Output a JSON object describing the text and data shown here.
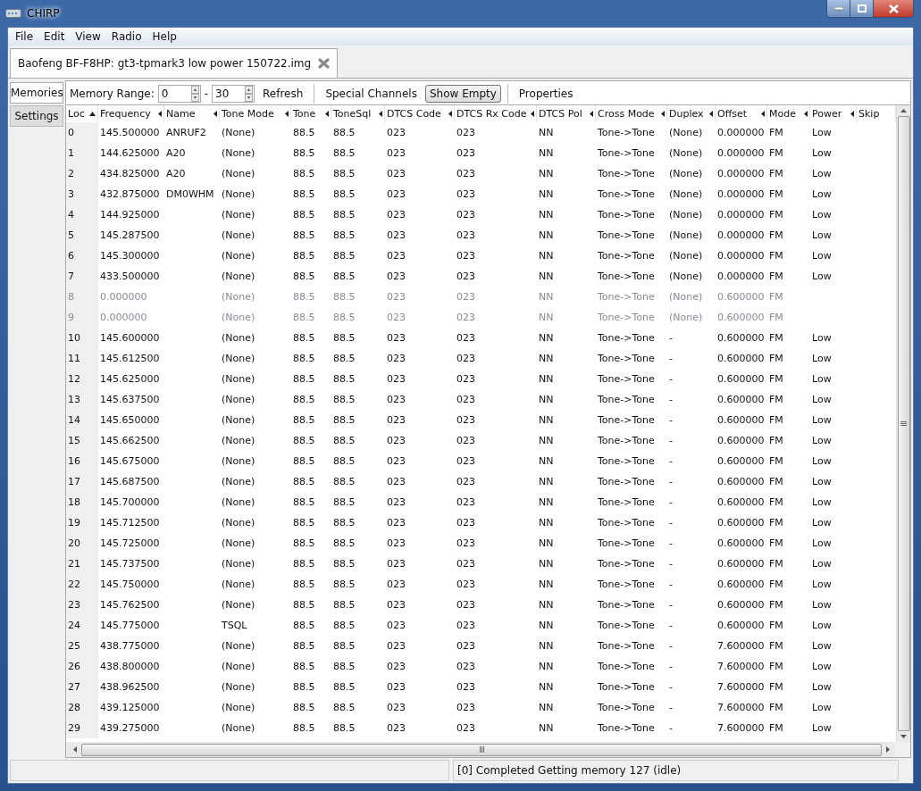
{
  "window": {
    "title": "CHIRP"
  },
  "menu": [
    "File",
    "Edit",
    "View",
    "Radio",
    "Help"
  ],
  "file_tab": {
    "label": "Baofeng BF-F8HP: gt3-tpmark3 low power 150722.img",
    "selected": true
  },
  "side_tabs": [
    {
      "label": "Memories",
      "selected": true
    },
    {
      "label": "Settings",
      "selected": false
    }
  ],
  "toolbar": {
    "range_label": "Memory Range:",
    "range_start": "0",
    "range_sep": "-",
    "range_end": "30",
    "refresh": "Refresh",
    "special": "Special Channels",
    "show_empty": {
      "label": "Show Empty",
      "on": true
    },
    "properties": "Properties"
  },
  "table": {
    "columns": [
      {
        "label": "Loc",
        "sorted": true
      },
      {
        "label": "Frequency",
        "sorted": false
      },
      {
        "label": "Name",
        "sorted": false
      },
      {
        "label": "Tone Mode",
        "sorted": false
      },
      {
        "label": "Tone",
        "sorted": false
      },
      {
        "label": "ToneSql",
        "sorted": false
      },
      {
        "label": "DTCS Code",
        "sorted": false
      },
      {
        "label": "DTCS Rx Code",
        "sorted": false
      },
      {
        "label": "DTCS Pol",
        "sorted": false
      },
      {
        "label": "Cross Mode",
        "sorted": false
      },
      {
        "label": "Duplex",
        "sorted": false
      },
      {
        "label": "Offset",
        "sorted": false
      },
      {
        "label": "Mode",
        "sorted": false
      },
      {
        "label": "Power",
        "sorted": false
      },
      {
        "label": "Skip"
      }
    ],
    "rows": [
      {
        "empty": false,
        "cells": [
          "0",
          "145.500000",
          "ANRUF2",
          "(None)",
          "88.5",
          "88.5",
          "023",
          "023",
          "NN",
          "Tone->Tone",
          "(None)",
          "0.000000",
          "FM",
          "Low"
        ]
      },
      {
        "empty": false,
        "cells": [
          "1",
          "144.625000",
          "A20",
          "(None)",
          "88.5",
          "88.5",
          "023",
          "023",
          "NN",
          "Tone->Tone",
          "(None)",
          "0.000000",
          "FM",
          "Low"
        ]
      },
      {
        "empty": false,
        "cells": [
          "2",
          "434.825000",
          "A20",
          "(None)",
          "88.5",
          "88.5",
          "023",
          "023",
          "NN",
          "Tone->Tone",
          "(None)",
          "0.000000",
          "FM",
          "Low"
        ]
      },
      {
        "empty": false,
        "cells": [
          "3",
          "432.875000",
          "DM0WHM",
          "(None)",
          "88.5",
          "88.5",
          "023",
          "023",
          "NN",
          "Tone->Tone",
          "(None)",
          "0.000000",
          "FM",
          "Low"
        ]
      },
      {
        "empty": false,
        "cells": [
          "4",
          "144.925000",
          null,
          "(None)",
          "88.5",
          "88.5",
          "023",
          "023",
          "NN",
          "Tone->Tone",
          "(None)",
          "0.000000",
          "FM",
          "Low"
        ]
      },
      {
        "empty": false,
        "cells": [
          "5",
          "145.287500",
          null,
          "(None)",
          "88.5",
          "88.5",
          "023",
          "023",
          "NN",
          "Tone->Tone",
          "(None)",
          "0.000000",
          "FM",
          "Low"
        ]
      },
      {
        "empty": false,
        "cells": [
          "6",
          "145.300000",
          null,
          "(None)",
          "88.5",
          "88.5",
          "023",
          "023",
          "NN",
          "Tone->Tone",
          "(None)",
          "0.000000",
          "FM",
          "Low"
        ]
      },
      {
        "empty": false,
        "cells": [
          "7",
          "433.500000",
          null,
          "(None)",
          "88.5",
          "88.5",
          "023",
          "023",
          "NN",
          "Tone->Tone",
          "(None)",
          "0.000000",
          "FM",
          "Low"
        ]
      },
      {
        "empty": true,
        "cells": [
          "8",
          "0.000000",
          null,
          "(None)",
          "88.5",
          "88.5",
          "023",
          "023",
          "NN",
          "Tone->Tone",
          "(None)",
          "0.600000",
          "FM",
          null
        ]
      },
      {
        "empty": true,
        "cells": [
          "9",
          "0.000000",
          null,
          "(None)",
          "88.5",
          "88.5",
          "023",
          "023",
          "NN",
          "Tone->Tone",
          "(None)",
          "0.600000",
          "FM",
          null
        ]
      },
      {
        "empty": false,
        "cells": [
          "10",
          "145.600000",
          null,
          "(None)",
          "88.5",
          "88.5",
          "023",
          "023",
          "NN",
          "Tone->Tone",
          "-",
          "0.600000",
          "FM",
          "Low"
        ]
      },
      {
        "empty": false,
        "cells": [
          "11",
          "145.612500",
          null,
          "(None)",
          "88.5",
          "88.5",
          "023",
          "023",
          "NN",
          "Tone->Tone",
          "-",
          "0.600000",
          "FM",
          "Low"
        ]
      },
      {
        "empty": false,
        "cells": [
          "12",
          "145.625000",
          null,
          "(None)",
          "88.5",
          "88.5",
          "023",
          "023",
          "NN",
          "Tone->Tone",
          "-",
          "0.600000",
          "FM",
          "Low"
        ]
      },
      {
        "empty": false,
        "cells": [
          "13",
          "145.637500",
          null,
          "(None)",
          "88.5",
          "88.5",
          "023",
          "023",
          "NN",
          "Tone->Tone",
          "-",
          "0.600000",
          "FM",
          "Low"
        ]
      },
      {
        "empty": false,
        "cells": [
          "14",
          "145.650000",
          null,
          "(None)",
          "88.5",
          "88.5",
          "023",
          "023",
          "NN",
          "Tone->Tone",
          "-",
          "0.600000",
          "FM",
          "Low"
        ]
      },
      {
        "empty": false,
        "cells": [
          "15",
          "145.662500",
          null,
          "(None)",
          "88.5",
          "88.5",
          "023",
          "023",
          "NN",
          "Tone->Tone",
          "-",
          "0.600000",
          "FM",
          "Low"
        ]
      },
      {
        "empty": false,
        "cells": [
          "16",
          "145.675000",
          null,
          "(None)",
          "88.5",
          "88.5",
          "023",
          "023",
          "NN",
          "Tone->Tone",
          "-",
          "0.600000",
          "FM",
          "Low"
        ]
      },
      {
        "empty": false,
        "cells": [
          "17",
          "145.687500",
          null,
          "(None)",
          "88.5",
          "88.5",
          "023",
          "023",
          "NN",
          "Tone->Tone",
          "-",
          "0.600000",
          "FM",
          "Low"
        ]
      },
      {
        "empty": false,
        "cells": [
          "18",
          "145.700000",
          null,
          "(None)",
          "88.5",
          "88.5",
          "023",
          "023",
          "NN",
          "Tone->Tone",
          "-",
          "0.600000",
          "FM",
          "Low"
        ]
      },
      {
        "empty": false,
        "cells": [
          "19",
          "145.712500",
          null,
          "(None)",
          "88.5",
          "88.5",
          "023",
          "023",
          "NN",
          "Tone->Tone",
          "-",
          "0.600000",
          "FM",
          "Low"
        ]
      },
      {
        "empty": false,
        "cells": [
          "20",
          "145.725000",
          null,
          "(None)",
          "88.5",
          "88.5",
          "023",
          "023",
          "NN",
          "Tone->Tone",
          "-",
          "0.600000",
          "FM",
          "Low"
        ]
      },
      {
        "empty": false,
        "cells": [
          "21",
          "145.737500",
          null,
          "(None)",
          "88.5",
          "88.5",
          "023",
          "023",
          "NN",
          "Tone->Tone",
          "-",
          "0.600000",
          "FM",
          "Low"
        ]
      },
      {
        "empty": false,
        "cells": [
          "22",
          "145.750000",
          null,
          "(None)",
          "88.5",
          "88.5",
          "023",
          "023",
          "NN",
          "Tone->Tone",
          "-",
          "0.600000",
          "FM",
          "Low"
        ]
      },
      {
        "empty": false,
        "cells": [
          "23",
          "145.762500",
          null,
          "(None)",
          "88.5",
          "88.5",
          "023",
          "023",
          "NN",
          "Tone->Tone",
          "-",
          "0.600000",
          "FM",
          "Low"
        ]
      },
      {
        "empty": false,
        "cells": [
          "24",
          "145.775000",
          null,
          "TSQL",
          "88.5",
          "88.5",
          "023",
          "023",
          "NN",
          "Tone->Tone",
          "-",
          "0.600000",
          "FM",
          "Low"
        ]
      },
      {
        "empty": false,
        "cells": [
          "25",
          "438.775000",
          null,
          "(None)",
          "88.5",
          "88.5",
          "023",
          "023",
          "NN",
          "Tone->Tone",
          "-",
          "7.600000",
          "FM",
          "Low"
        ]
      },
      {
        "empty": false,
        "cells": [
          "26",
          "438.800000",
          null,
          "(None)",
          "88.5",
          "88.5",
          "023",
          "023",
          "NN",
          "Tone->Tone",
          "-",
          "7.600000",
          "FM",
          "Low"
        ]
      },
      {
        "empty": false,
        "cells": [
          "27",
          "438.962500",
          null,
          "(None)",
          "88.5",
          "88.5",
          "023",
          "023",
          "NN",
          "Tone->Tone",
          "-",
          "7.600000",
          "FM",
          "Low"
        ]
      },
      {
        "empty": false,
        "cells": [
          "28",
          "439.125000",
          null,
          "(None)",
          "88.5",
          "88.5",
          "023",
          "023",
          "NN",
          "Tone->Tone",
          "-",
          "7.600000",
          "FM",
          "Low"
        ]
      },
      {
        "empty": false,
        "cells": [
          "29",
          "439.275000",
          null,
          "(None)",
          "88.5",
          "88.5",
          "023",
          "023",
          "NN",
          "Tone->Tone",
          "-",
          "7.600000",
          "FM",
          "Low"
        ]
      }
    ]
  },
  "status_bar": "[0] Completed Getting memory 127 (idle)"
}
